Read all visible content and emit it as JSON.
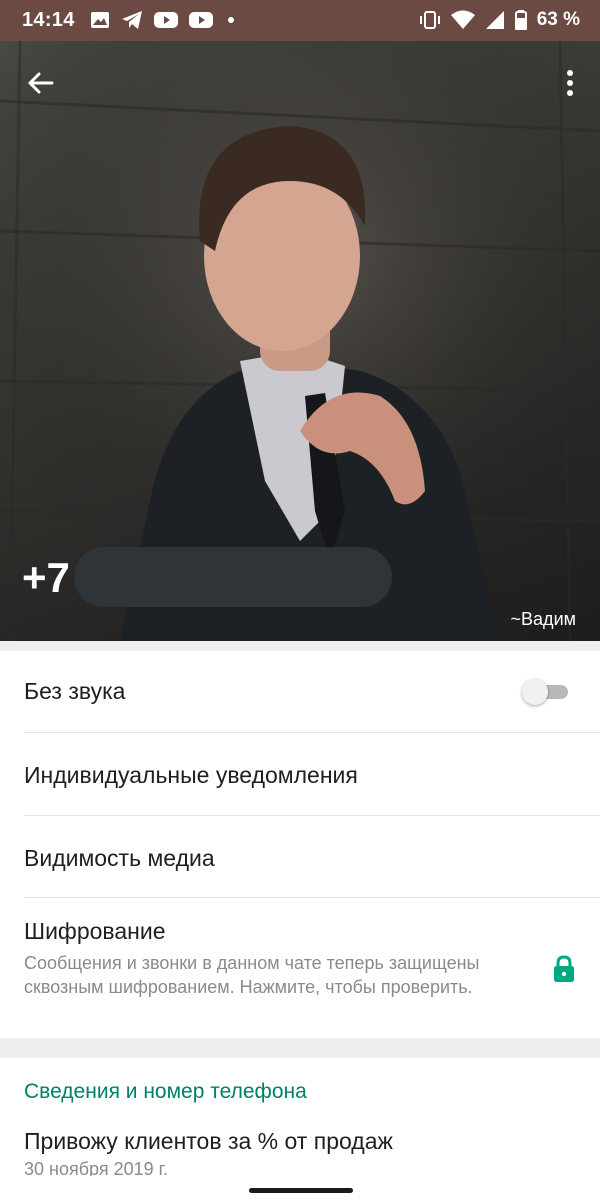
{
  "status_bar": {
    "time": "14:14",
    "battery": "63 %",
    "icons": [
      "image-icon",
      "telegram-icon",
      "youtube-icon",
      "youtube-icon",
      "dot-icon",
      "vibrate-icon",
      "wifi-icon",
      "signal-icon",
      "battery-icon"
    ]
  },
  "header": {
    "phone_prefix": "+7",
    "contact_name": "~Вадим",
    "back_icon": "arrow-back-icon",
    "menu_icon": "more-vert-icon"
  },
  "settings": {
    "mute_label": "Без звука",
    "mute_on": false,
    "custom_notifications_label": "Индивидуальные уведомления",
    "media_visibility_label": "Видимость медиа",
    "encryption_title": "Шифрование",
    "encryption_subtitle": "Сообщения и звонки в данном чате теперь защищены сквозным шифрованием. Нажмите, чтобы проверить."
  },
  "about": {
    "section_title": "Сведения и номер телефона",
    "text": "Привожу клиентов за % от продаж",
    "date": "30 ноября 2019 г."
  },
  "colors": {
    "status_bar": "#6b4a43",
    "accent": "#008069",
    "lock": "#00a884"
  }
}
